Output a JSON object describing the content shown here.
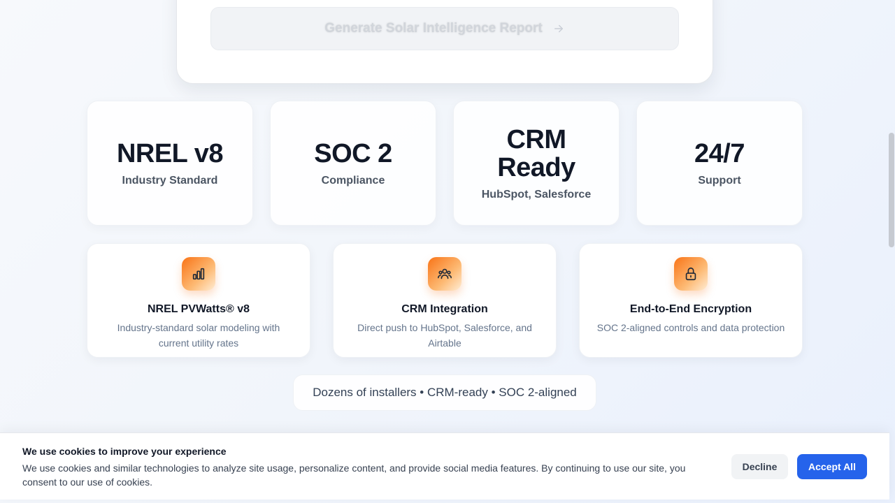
{
  "form": {
    "generate_label": "Generate Solar Intelligence Report",
    "generate_icon": "arrow-right-icon"
  },
  "stats": [
    {
      "value": "NREL v8",
      "label": "Industry Standard"
    },
    {
      "value": "SOC 2",
      "label": "Compliance"
    },
    {
      "value": "CRM Ready",
      "label": "HubSpot, Salesforce"
    },
    {
      "value": "24/7",
      "label": "Support"
    }
  ],
  "features": [
    {
      "icon": "bar-chart-icon",
      "title": "NREL PVWatts® v8",
      "description": "Industry-standard solar modeling with current utility rates"
    },
    {
      "icon": "users-icon",
      "title": "CRM Integration",
      "description": "Direct push to HubSpot, Salesforce, and Airtable"
    },
    {
      "icon": "lock-icon",
      "title": "End-to-End Encryption",
      "description": "SOC 2-aligned controls and data protection"
    }
  ],
  "trust_line": "Dozens of installers • CRM-ready • SOC 2-aligned",
  "cookie": {
    "title": "We use cookies to improve your experience",
    "text": "We use cookies and similar technologies to analyze site usage, personalize content, and provide social media features. By continuing to use our site, you consent to our use of cookies.",
    "decline_label": "Decline",
    "accept_label": "Accept All"
  },
  "colors": {
    "accent": "#2563eb",
    "icon_gradient_start": "#f97316",
    "icon_gradient_end": "#fdba74"
  }
}
